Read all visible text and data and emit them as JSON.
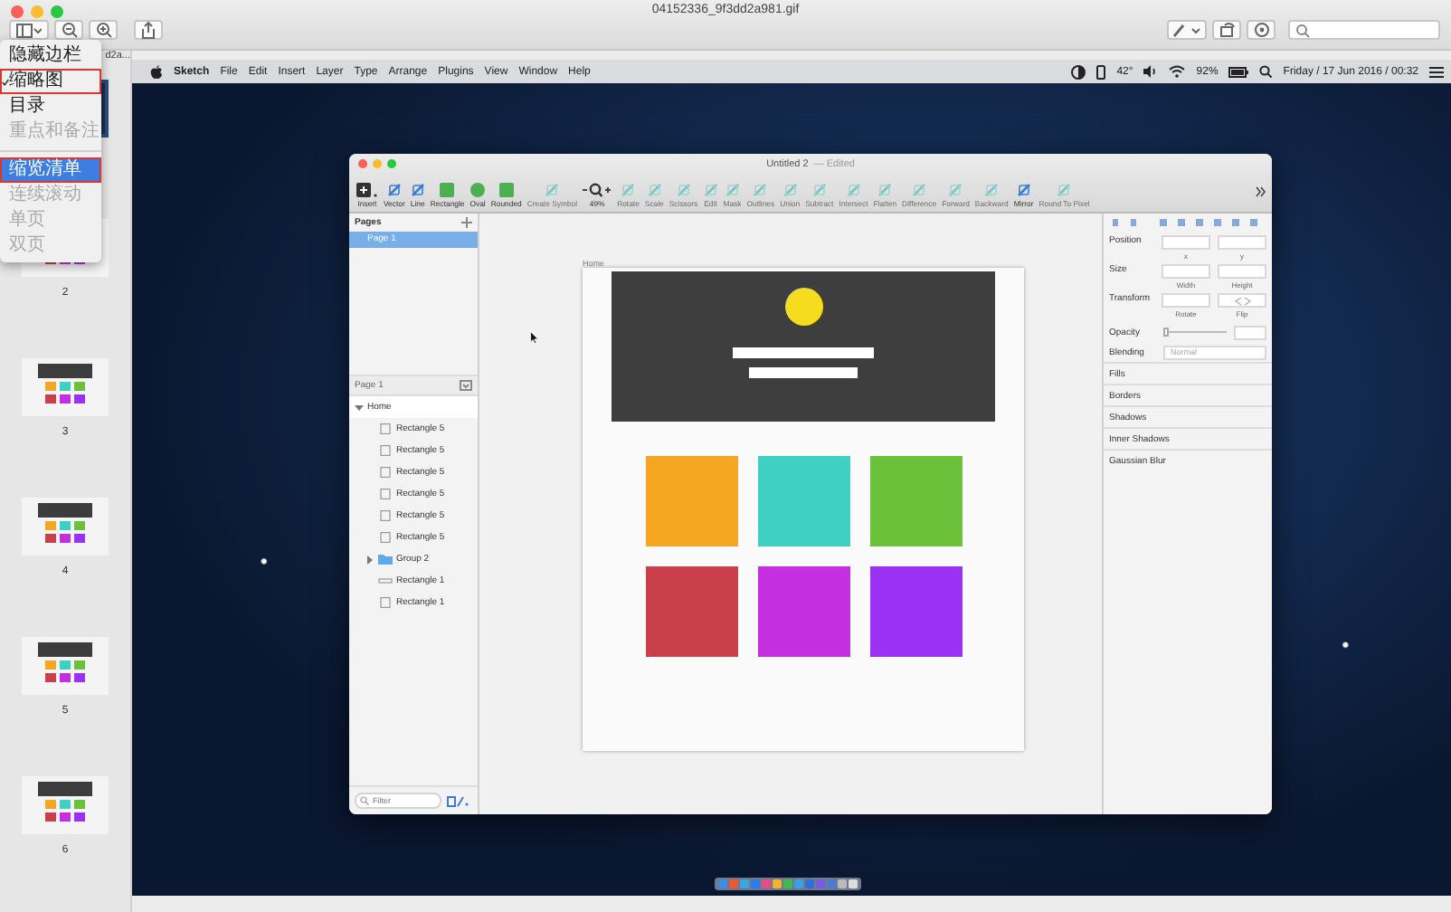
{
  "viewer": {
    "title": "04152336_9f3dd2a981.gif"
  },
  "sidebar": {
    "tab_label": "d2a...",
    "thumbnails": [
      {
        "selected": true
      },
      {
        "label": "2",
        "selected": false
      },
      {
        "label": "3",
        "selected": false
      },
      {
        "label": "4",
        "selected": false
      },
      {
        "label": "5",
        "selected": false
      },
      {
        "label": "6",
        "selected": false
      }
    ]
  },
  "view_menu": {
    "items": [
      {
        "kind": "item",
        "label": "隐藏边栏",
        "checked": false,
        "disabled": false,
        "selected": false,
        "annotated": false
      },
      {
        "kind": "item",
        "label": "缩略图",
        "checked": true,
        "disabled": false,
        "selected": false,
        "annotated": true
      },
      {
        "kind": "item",
        "label": "目录",
        "checked": false,
        "disabled": false,
        "selected": false,
        "annotated": false
      },
      {
        "kind": "item",
        "label": "重点和备注",
        "checked": false,
        "disabled": true,
        "selected": false,
        "annotated": false
      },
      {
        "kind": "separator"
      },
      {
        "kind": "item",
        "label": "缩览清单",
        "checked": false,
        "disabled": false,
        "selected": true,
        "annotated": true
      },
      {
        "kind": "item",
        "label": "连续滚动",
        "checked": false,
        "disabled": true,
        "selected": false,
        "annotated": false
      },
      {
        "kind": "item",
        "label": "单页",
        "checked": false,
        "disabled": true,
        "selected": false,
        "annotated": false
      },
      {
        "kind": "item",
        "label": "双页",
        "checked": false,
        "disabled": true,
        "selected": false,
        "annotated": false
      }
    ]
  },
  "menubar": {
    "app": "Sketch",
    "menus": [
      "File",
      "Edit",
      "Insert",
      "Layer",
      "Type",
      "Arrange",
      "Plugins",
      "View",
      "Window",
      "Help"
    ],
    "temperature": "42°",
    "battery": "92%",
    "clock": "Friday / 17 Jun 2016 / 00:32"
  },
  "sketch": {
    "title": "Untitled 2",
    "status": "— Edited",
    "toolbar": [
      {
        "kind": "insert",
        "label": "Insert",
        "disabled": false
      },
      {
        "kind": "tool",
        "label": "Vector",
        "disabled": false
      },
      {
        "kind": "tool",
        "label": "Line",
        "disabled": false
      },
      {
        "kind": "shape",
        "label": "Rectangle",
        "disabled": false
      },
      {
        "kind": "oval",
        "label": "Oval",
        "disabled": false
      },
      {
        "kind": "shape",
        "label": "Rounded",
        "disabled": false
      },
      {
        "kind": "tool",
        "label": "Create Symbol",
        "disabled": true
      },
      {
        "kind": "zoom",
        "label": "49%",
        "disabled": false
      },
      {
        "kind": "tool",
        "label": "Rotate",
        "disabled": true
      },
      {
        "kind": "tool",
        "label": "Scale",
        "disabled": true
      },
      {
        "kind": "tool",
        "label": "Scissors",
        "disabled": true
      },
      {
        "kind": "tool",
        "label": "Edit",
        "disabled": true
      },
      {
        "kind": "tool",
        "label": "Mask",
        "disabled": true
      },
      {
        "kind": "tool",
        "label": "Outlines",
        "disabled": true
      },
      {
        "kind": "tool",
        "label": "Union",
        "disabled": true
      },
      {
        "kind": "tool",
        "label": "Subtract",
        "disabled": true
      },
      {
        "kind": "tool",
        "label": "Intersect",
        "disabled": true
      },
      {
        "kind": "tool",
        "label": "Flatten",
        "disabled": true
      },
      {
        "kind": "tool",
        "label": "Difference",
        "disabled": true
      },
      {
        "kind": "tool",
        "label": "Forward",
        "disabled": true
      },
      {
        "kind": "tool",
        "label": "Backward",
        "disabled": true
      },
      {
        "kind": "tool",
        "label": "Mirror",
        "disabled": false
      },
      {
        "kind": "tool",
        "label": "Round To Pixel",
        "disabled": true
      }
    ],
    "pages": {
      "title": "Pages",
      "items": [
        {
          "label": "Page 1",
          "selected": true
        }
      ]
    },
    "layers": {
      "title": "Page 1",
      "tree": [
        {
          "name": "Home",
          "kind": "artboard",
          "expanded": true,
          "children": [
            {
              "name": "Rectangle 5",
              "kind": "rect"
            },
            {
              "name": "Rectangle 5",
              "kind": "rect"
            },
            {
              "name": "Rectangle 5",
              "kind": "rect"
            },
            {
              "name": "Rectangle 5",
              "kind": "rect"
            },
            {
              "name": "Rectangle 5",
              "kind": "rect"
            },
            {
              "name": "Rectangle 5",
              "kind": "rect"
            },
            {
              "name": "Group 2",
              "kind": "group",
              "expanded": false
            },
            {
              "name": "Rectangle 1",
              "kind": "line"
            },
            {
              "name": "Rectangle 1",
              "kind": "rect"
            }
          ]
        }
      ],
      "filter": {
        "placeholder": "Filter"
      }
    },
    "artboard": {
      "name": "Home",
      "tiles": [
        {
          "color": "#f5a623"
        },
        {
          "color": "#3fd0c4"
        },
        {
          "color": "#6cc13a"
        },
        {
          "color": "#c9404a"
        },
        {
          "color": "#c42fe0"
        },
        {
          "color": "#9b31f2"
        }
      ]
    },
    "inspector": [
      {
        "kind": "pair",
        "label": "Position",
        "captions": [
          "x",
          "y"
        ]
      },
      {
        "kind": "pair",
        "label": "Size",
        "captions": [
          "Width",
          "Height"
        ]
      },
      {
        "kind": "transform",
        "label": "Transform",
        "captions": [
          "Rotate",
          "Flip"
        ]
      },
      {
        "kind": "slider",
        "label": "Opacity",
        "level": 0
      },
      {
        "kind": "select",
        "label": "Blending",
        "value": "Normal"
      },
      {
        "kind": "section",
        "label": "Fills"
      },
      {
        "kind": "section",
        "label": "Borders"
      },
      {
        "kind": "section",
        "label": "Shadows"
      },
      {
        "kind": "section",
        "label": "Inner Shadows"
      },
      {
        "kind": "section",
        "label": "Gaussian Blur"
      }
    ]
  }
}
